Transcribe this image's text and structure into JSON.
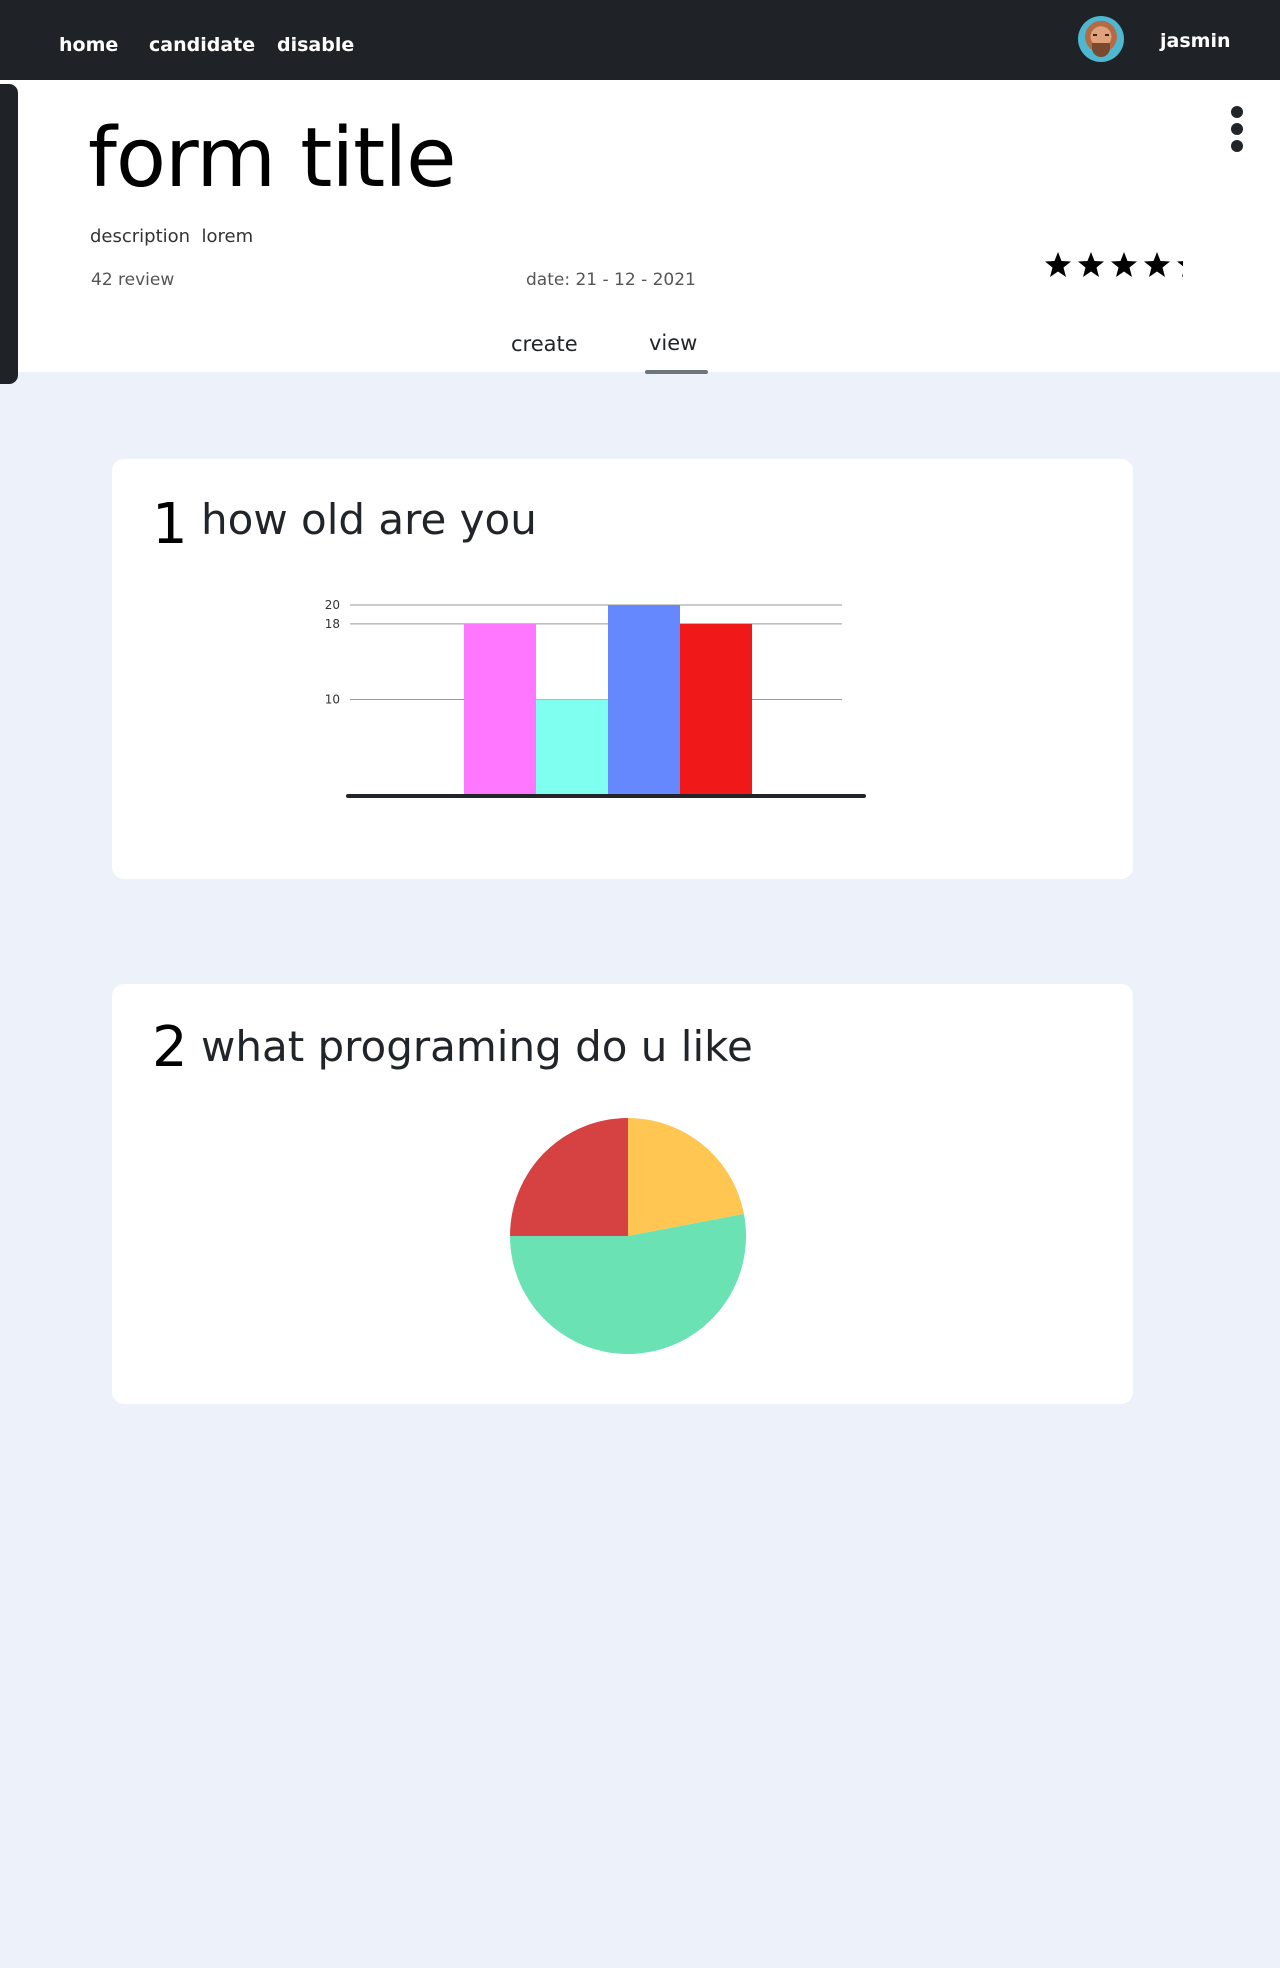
{
  "nav": {
    "links": [
      "home",
      "candidate",
      "disable"
    ],
    "username": "jasmin"
  },
  "form": {
    "title": "form title",
    "description": "description  lorem",
    "reviews": "42 review",
    "date": "date: 21 - 12 - 2021",
    "rating": 4.5,
    "rating_max": 5
  },
  "tabs": [
    "create",
    "view"
  ],
  "active_tab": "view",
  "questions": [
    {
      "number": "1",
      "text": "how old are you"
    },
    {
      "number": "2",
      "text": "what programing do u like"
    }
  ],
  "chart_data": [
    {
      "type": "bar",
      "values": [
        18,
        10,
        20,
        18
      ],
      "colors": [
        "#ff77ff",
        "#7ffff0",
        "#6688ff",
        "#f01818"
      ],
      "yticks": [
        10,
        18,
        20
      ],
      "ylim": [
        0,
        20
      ]
    },
    {
      "type": "pie",
      "values": [
        25,
        22,
        53
      ],
      "colors": [
        "#d64141",
        "#ffc652",
        "#6be2b3"
      ]
    }
  ]
}
